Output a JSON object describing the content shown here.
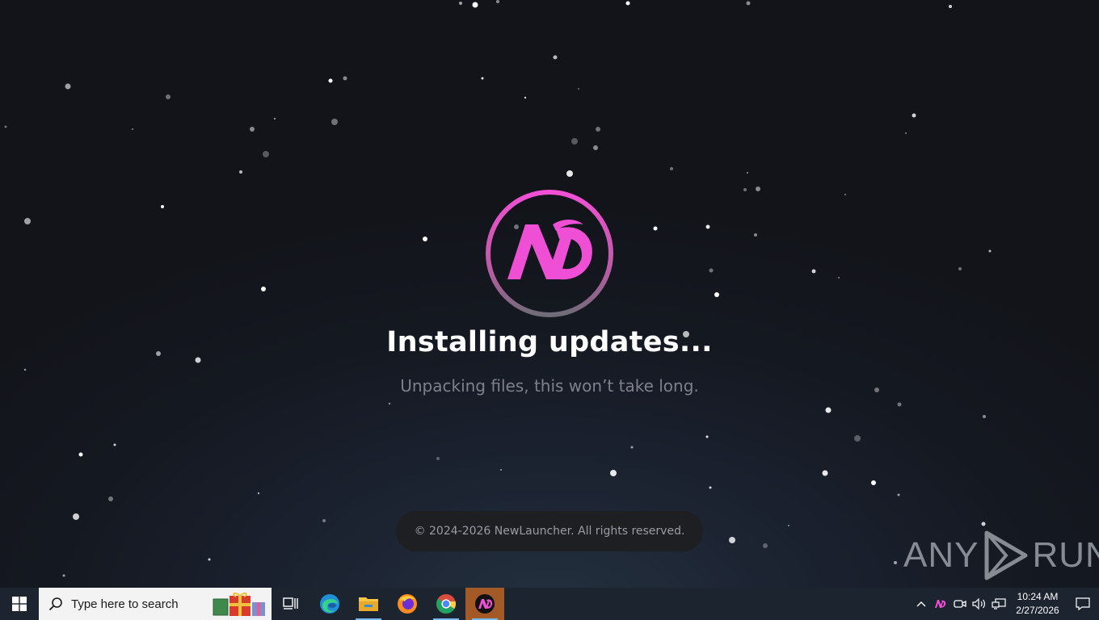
{
  "launcher": {
    "title": "Installing updates...",
    "subtitle": "Unpacking files, this won’t take long.",
    "copyright": "© 2024-2026 NewLauncher. All rights reserved.",
    "accent_color": "#e94fd0"
  },
  "watermark": {
    "text_left": "ANY",
    "text_right": "RUN"
  },
  "taskbar": {
    "search_placeholder": "Type here to search",
    "pinned_apps": [
      {
        "name": "task-view-icon"
      },
      {
        "name": "edge-icon"
      },
      {
        "name": "file-explorer-icon"
      },
      {
        "name": "firefox-icon"
      },
      {
        "name": "chrome-icon"
      },
      {
        "name": "newlauncher-icon"
      }
    ],
    "clock_time": "10:24 AM",
    "clock_date": "2/27/2026"
  }
}
